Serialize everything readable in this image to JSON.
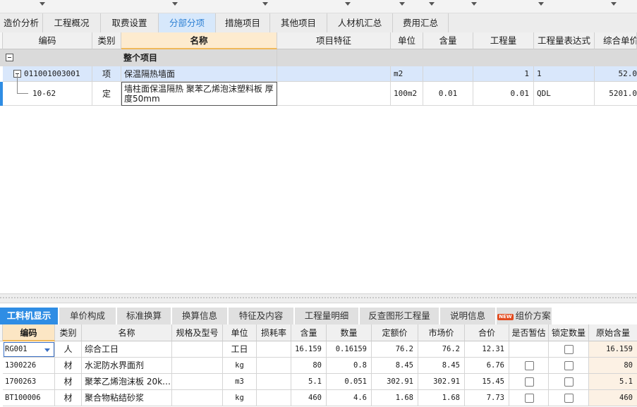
{
  "main_tabs": [
    "造价分析",
    "工程概况",
    "取费设置",
    "分部分项",
    "措施项目",
    "其他项目",
    "人材机汇总",
    "费用汇总"
  ],
  "main_active": "分部分项",
  "upper": {
    "headers": [
      "编码",
      "类别",
      "名称",
      "项目特征",
      "单位",
      "含量",
      "工程量",
      "工程量表达式",
      "综合单价"
    ],
    "group_row": {
      "label": "整个项目"
    },
    "rows": [
      {
        "code": "011001003001",
        "type": "项",
        "name": "保温隔热墙面",
        "feature": "",
        "unit": "m2",
        "content": "",
        "qty": "1",
        "expr": "1",
        "price": "52.0"
      },
      {
        "code": "10-62",
        "type": "定",
        "name": "墙柱面保温隔热 聚苯乙烯泡沫塑料板 厚度50mm",
        "feature": "",
        "unit": "100m2",
        "content": "0.01",
        "qty": "0.01",
        "expr": "QDL",
        "price": "5201.0"
      }
    ]
  },
  "bottom_tabs": [
    "工料机显示",
    "单价构成",
    "标准换算",
    "换算信息",
    "特征及内容",
    "工程量明细",
    "反查图形工程量",
    "说明信息",
    "组价方案"
  ],
  "bottom_active": "工料机显示",
  "new_badge": "NEW",
  "lower": {
    "headers": [
      "编码",
      "类别",
      "名称",
      "规格及型号",
      "单位",
      "损耗率",
      "含量",
      "数量",
      "定额价",
      "市场价",
      "合价",
      "是否暂估",
      "锁定数量",
      "原始含量"
    ],
    "rows": [
      {
        "code": "RG001",
        "type": "人",
        "name": "综合工日",
        "spec": "",
        "unit": "工日",
        "loss": "",
        "content": "16.159",
        "qty": "0.16159",
        "quota": "76.2",
        "market": "76.2",
        "total": "12.31",
        "estimate_checkbox": false,
        "locked_checked": false,
        "orig": "16.159"
      },
      {
        "code": "1300226",
        "type": "材",
        "name": "水泥防水界面剂",
        "spec": "",
        "unit": "kg",
        "loss": "",
        "content": "80",
        "qty": "0.8",
        "quota": "8.45",
        "market": "8.45",
        "total": "6.76",
        "estimate_checkbox": true,
        "locked_checked": false,
        "orig": "80"
      },
      {
        "code": "1700263",
        "type": "材",
        "name": "聚苯乙烯泡沫板 20k…",
        "spec": "",
        "unit": "m3",
        "loss": "",
        "content": "5.1",
        "qty": "0.051",
        "quota": "302.91",
        "market": "302.91",
        "total": "15.45",
        "estimate_checkbox": true,
        "locked_checked": false,
        "orig": "5.1"
      },
      {
        "code": "BT100006",
        "type": "材",
        "name": "聚合物粘结砂浆",
        "spec": "",
        "unit": "kg",
        "loss": "",
        "content": "460",
        "qty": "4.6",
        "quota": "1.68",
        "market": "1.68",
        "total": "7.73",
        "estimate_checkbox": true,
        "locked_checked": false,
        "orig": "460"
      }
    ]
  },
  "icons": {
    "expand": "collapse-box-icon",
    "dropdown": "chevron-down-icon"
  },
  "colors": {
    "active_tab_bg": "#2f8de4",
    "main_active_text": "#2b7fd3",
    "selected_row_bg": "#d9e7fb",
    "name_header_bg": "#fdebcf"
  }
}
